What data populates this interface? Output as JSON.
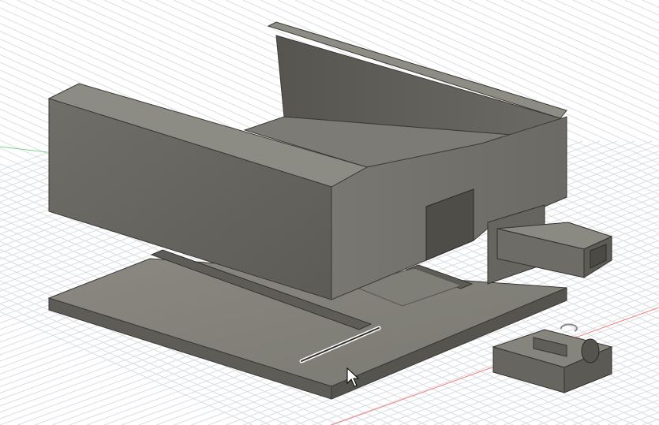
{
  "app": {
    "view": "3d-viewport",
    "background_color": "#ffffff",
    "grid_color": "#d9dde3",
    "x_axis_color": "#e66a6a",
    "y_axis_color": "#5fc466"
  },
  "scene": {
    "model_color": "#6a6963",
    "model_edge_color": "#2b2a27",
    "selection_highlight_color": "#ffffff",
    "parts": [
      {
        "name": "main-housing-body",
        "icon": "solid-body"
      },
      {
        "name": "base-plate",
        "icon": "solid-body"
      },
      {
        "name": "right-clip-connector",
        "icon": "solid-body"
      },
      {
        "name": "small-separate-block",
        "icon": "solid-body"
      }
    ],
    "selected_edge": "slot-edge",
    "cursor": "mouse-pointer-icon",
    "rotation_indicator": "orbit-icon"
  }
}
